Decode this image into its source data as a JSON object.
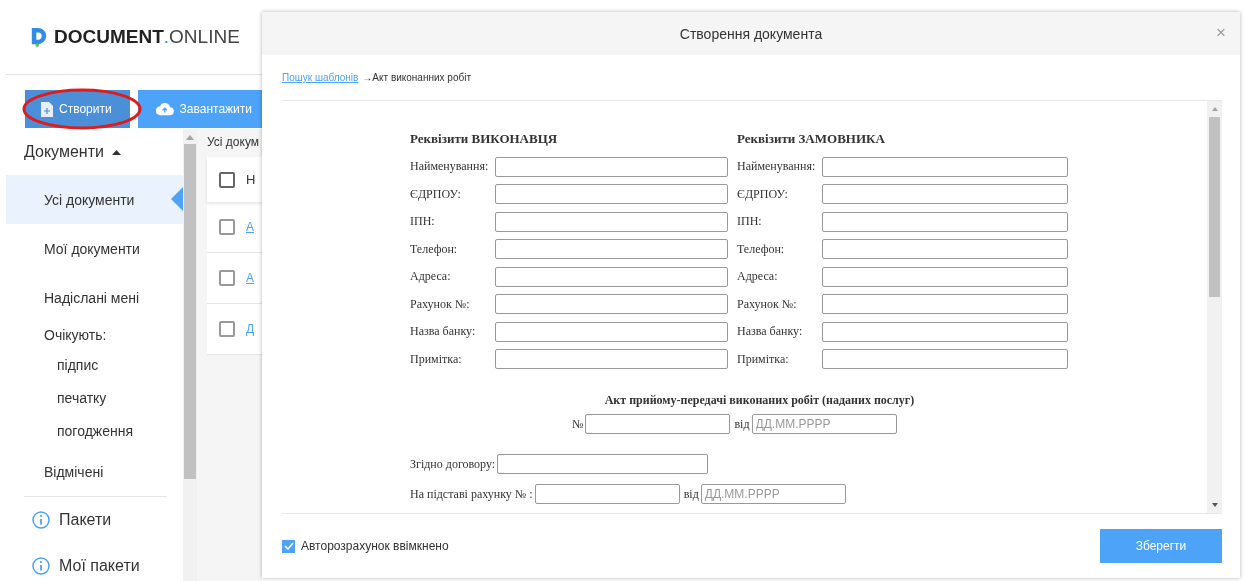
{
  "logo": {
    "bold": "DOCUMENT",
    "dot": ".",
    "light": "ONLINE"
  },
  "toolbar": [
    {
      "label": "Створити",
      "kind": "create",
      "highlighted": true
    },
    {
      "label": "Завантажити",
      "kind": "upload",
      "highlighted": false
    }
  ],
  "sidebar": {
    "section": {
      "label": "Документи",
      "expanded": true
    },
    "items": [
      {
        "label": "Усі документи",
        "kind": "item",
        "selected": true
      },
      {
        "label": "Мої документи",
        "kind": "item",
        "selected": false
      },
      {
        "label": "Надіслані мені",
        "kind": "item",
        "selected": false
      },
      {
        "label": "Очікують:",
        "kind": "group",
        "selected": false
      },
      {
        "label": "підпис",
        "kind": "subitem",
        "selected": false
      },
      {
        "label": "печатку",
        "kind": "subitem",
        "selected": false
      },
      {
        "label": "погодження",
        "kind": "subitem",
        "selected": false
      },
      {
        "label": "Відмічені",
        "kind": "item",
        "selected": false
      }
    ],
    "footer_items": [
      {
        "label": "Пакети"
      },
      {
        "label": "Мої пакети"
      }
    ]
  },
  "table": {
    "title": "Усі докум",
    "header": {
      "label": "Н",
      "checked": false
    },
    "rows": [
      {
        "label": "А",
        "checked": false
      },
      {
        "label": "А",
        "checked": false
      },
      {
        "label": "Д",
        "checked": false
      }
    ]
  },
  "modal": {
    "title": "Створення документа",
    "close": "×",
    "breadcrumb": {
      "link": "Пошук шаблонів",
      "current": "→Акт виконанних робіт"
    },
    "parties": [
      {
        "heading": "Реквізити ВИКОНАВЦЯ",
        "fields": [
          "Найменування:",
          "ЄДРПОУ:",
          "ІПН:",
          "Телефон:",
          "Адреса:",
          "Рахунок №:",
          "Назва банку:",
          "Примітка:"
        ]
      },
      {
        "heading": "Реквізити ЗАМОВНИКА",
        "fields": [
          "Найменування:",
          "ЄДРПОУ:",
          "ІПН:",
          "Телефон:",
          "Адреса:",
          "Рахунок №:",
          "Назва банку:",
          "Примітка:"
        ]
      }
    ],
    "act": {
      "title": "Акт прийому-передачі виконаних робіт (наданих послуг)",
      "number_label": "№",
      "date_label": "від",
      "date_placeholder": "ДД.ММ.РРРР"
    },
    "contract": {
      "label": "Згідно договору:"
    },
    "invoice": {
      "label": "На підставі рахунку № :",
      "date_label": "від",
      "date_placeholder": "ДД.ММ.РРРР"
    },
    "autocalc": {
      "label": "Авторозрахунок ввімкнено",
      "checked": true
    },
    "save": "Зберегти"
  }
}
